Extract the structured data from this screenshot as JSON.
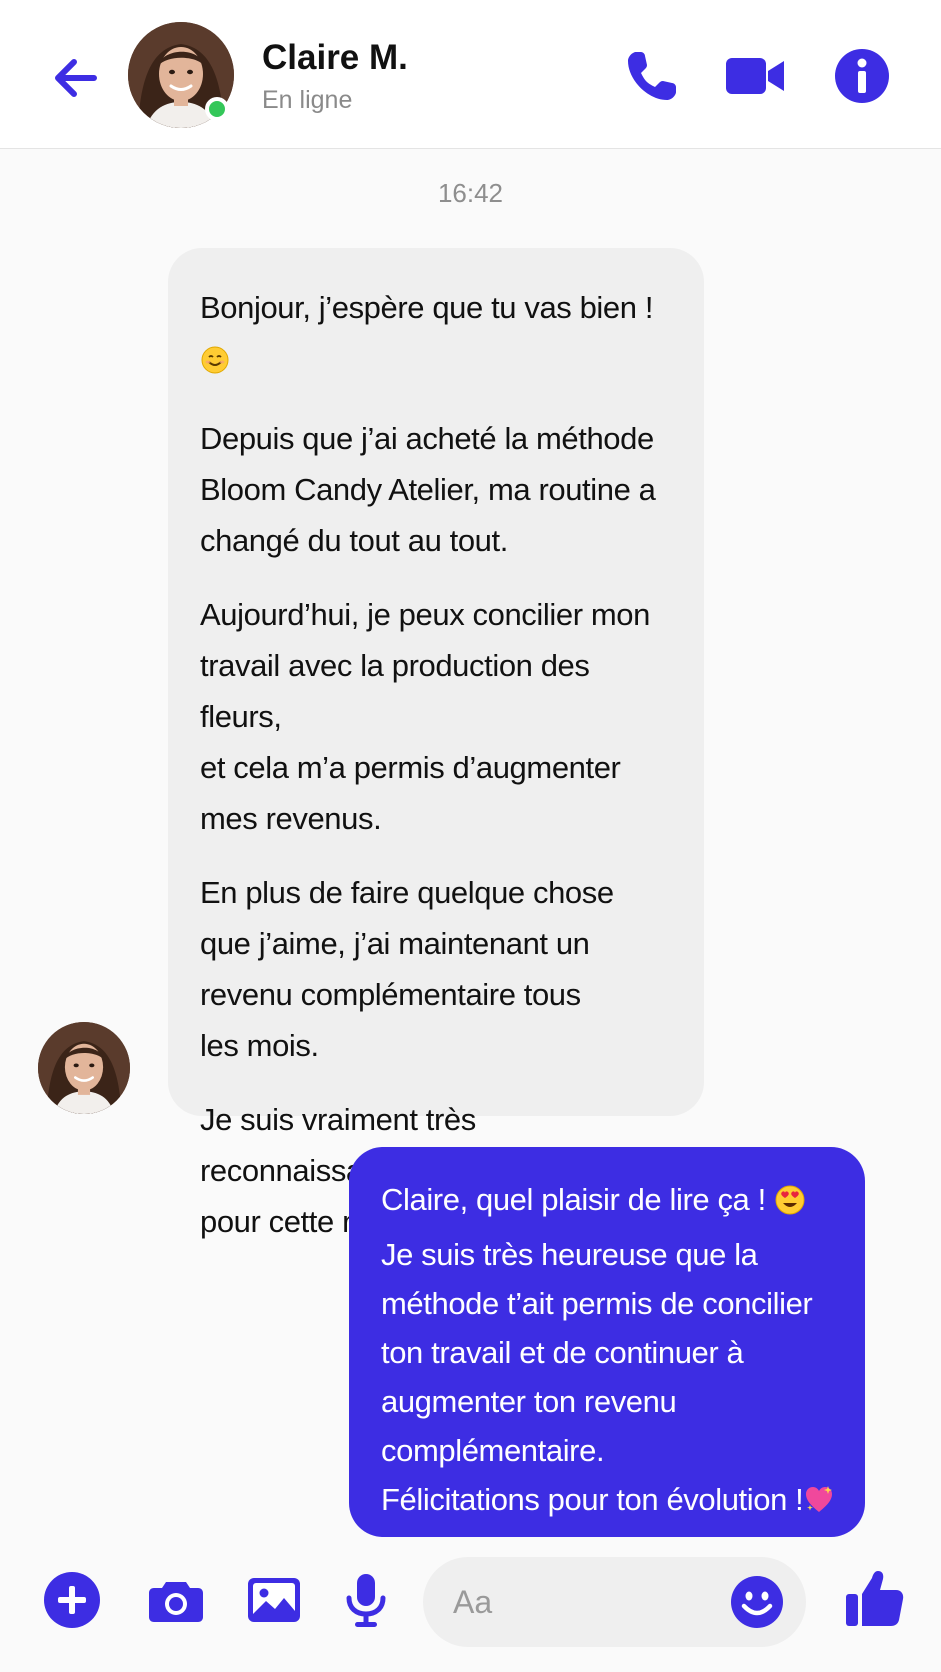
{
  "header": {
    "contact_name": "Claire M.",
    "status": "En ligne",
    "accent_color": "#3d2de3",
    "online_color": "#34c759",
    "icons": [
      "back-arrow-icon",
      "phone-icon",
      "video-camera-icon",
      "info-icon"
    ]
  },
  "conversation": {
    "timestamp": "16:42",
    "incoming": {
      "paragraphs": [
        [
          "Bonjour, j’espère que tu vas bien !"
        ],
        [
          "Depuis que j’ai acheté la méthode",
          "Bloom Candy Atelier, ma routine a",
          "changé du tout au tout."
        ],
        [
          "Aujourd’hui, je peux concilier mon",
          "travail avec la production des fleurs,",
          "et cela m’a permis d’augmenter",
          "mes revenus."
        ],
        [
          "En plus de faire quelque chose",
          "que j’aime, j’ai maintenant un",
          "revenu complémentaire tous",
          "les mois."
        ],
        [
          "Je suis vraiment très reconnaissante",
          "pour cette méthode !"
        ]
      ],
      "emojis": [
        "smiling-face-emoji",
        "sparkling-heart-emoji"
      ]
    },
    "outgoing": {
      "lines": [
        "Claire, quel plaisir de lire ça !",
        "Je suis très heureuse que la",
        "méthode t’ait permis de concilier",
        "ton travail et de continuer à",
        "augmenter ton revenu",
        "complémentaire.",
        "Félicitations pour ton évolution !"
      ],
      "emojis": [
        "heart-eyes-emoji",
        "sparkling-heart-emoji"
      ],
      "bubble_color": "#3d2de3"
    }
  },
  "composer": {
    "placeholder": "Aa",
    "icons": [
      "plus-icon",
      "camera-icon",
      "image-icon",
      "microphone-icon",
      "smiley-icon",
      "thumbs-up-icon"
    ]
  }
}
